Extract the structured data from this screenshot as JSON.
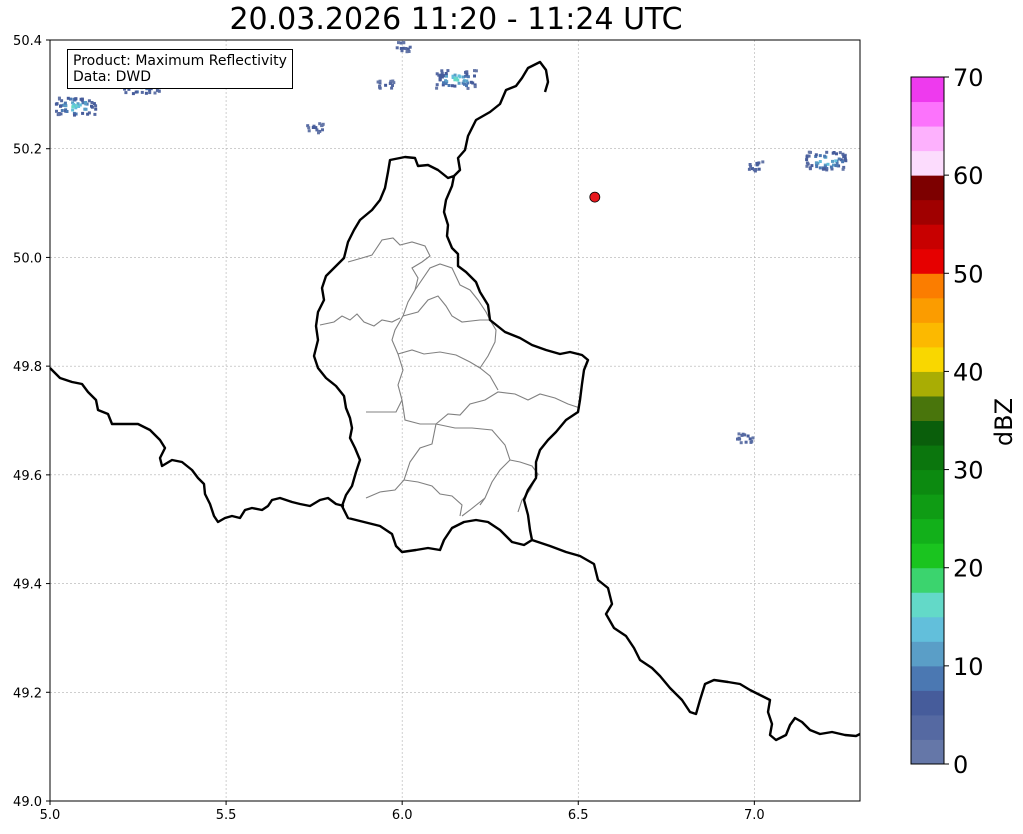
{
  "title": "20.03.2026 11:20 - 11:24 UTC",
  "info": {
    "product": "Product: Maximum Reflectivity",
    "data": "Data: DWD"
  },
  "map": {
    "lon_range": [
      5.0,
      7.3
    ],
    "lat_range": [
      49.0,
      50.4
    ],
    "lon_ticks": [
      "5.0",
      "5.5",
      "6.0",
      "6.5",
      "7.0"
    ],
    "lat_ticks": [
      "49.0",
      "49.2",
      "49.4",
      "49.6",
      "49.8",
      "50.0",
      "50.2",
      "50.4"
    ],
    "grid": "dotted",
    "marker": {
      "lon": 6.547,
      "lat": 50.111,
      "color": "#e8191e"
    },
    "national_border_color": "#000000",
    "district_border_color": "#808080",
    "echoes": [
      {
        "lon": 5.07,
        "lat": 50.28,
        "max_dbz": 17
      },
      {
        "lon": 5.25,
        "lat": 50.32,
        "max_dbz": 15
      },
      {
        "lon": 6.15,
        "lat": 50.33,
        "max_dbz": 17
      },
      {
        "lon": 6.0,
        "lat": 50.39,
        "max_dbz": 8
      },
      {
        "lon": 5.95,
        "lat": 50.32,
        "max_dbz": 7
      },
      {
        "lon": 5.75,
        "lat": 50.24,
        "max_dbz": 6
      },
      {
        "lon": 7.0,
        "lat": 50.17,
        "max_dbz": 9
      },
      {
        "lon": 7.2,
        "lat": 50.18,
        "max_dbz": 17
      },
      {
        "lon": 6.97,
        "lat": 49.67,
        "max_dbz": 8
      }
    ]
  },
  "colorbar": {
    "label": "dBZ",
    "ticks": [
      "0",
      "10",
      "20",
      "30",
      "40",
      "50",
      "60",
      "70"
    ],
    "range": [
      0,
      70
    ],
    "step": 2.5,
    "colors": [
      "#6577a8",
      "#5569a2",
      "#465c9b",
      "#4b78b2",
      "#5a9ec7",
      "#62bfdb",
      "#63d9c8",
      "#3bd46e",
      "#1ac41f",
      "#12b01a",
      "#0f9c14",
      "#0c8a10",
      "#0b760d",
      "#0a5e0b",
      "#49750c",
      "#a9ad04",
      "#f9d700",
      "#fcb900",
      "#fb9c00",
      "#fb7d00",
      "#e60000",
      "#c80000",
      "#a00000",
      "#7d0000",
      "#fcdcfd",
      "#fdb1fd",
      "#fc73fc",
      "#ee3aee"
    ]
  }
}
